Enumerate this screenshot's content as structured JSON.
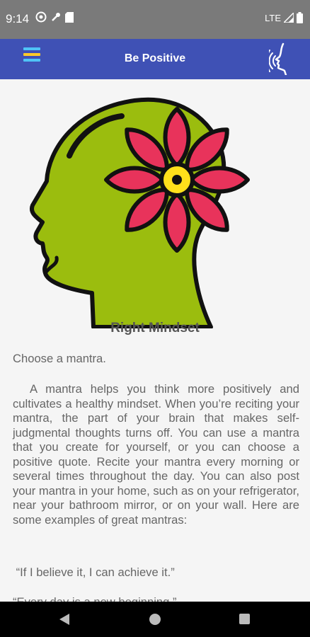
{
  "status_bar": {
    "time": "9:14",
    "network": "LTE"
  },
  "app_bar": {
    "title": "Be Positive",
    "menu_icon": "menu-icon",
    "voice_icon": "speaking-head-icon"
  },
  "colors": {
    "app_bar": "#3f51b5",
    "status_bar": "#7a7a7a",
    "head": "#9bbd0e",
    "petal": "#e8335b",
    "flower_center": "#ffe01b"
  },
  "content": {
    "title": "Right Mindset",
    "paragraphs": [
      "Choose a mantra.",
      "  A mantra helps you think more positively and cultivates a healthy mindset. When you’re reciting your mantra, the part of your brain that makes self-judgmental thoughts turns off. You can use a mantra that you create for yourself, or you can choose a positive quote. Recite your mantra every morning or several times throughout the day. You can also post your mantra in your home, such as on your refrigerator, near your bathroom mirror, or on your wall. Here are some examples of great mantras:",
      " “If I believe it, I can achieve it.”",
      "“Every day is a new beginning.”"
    ]
  }
}
